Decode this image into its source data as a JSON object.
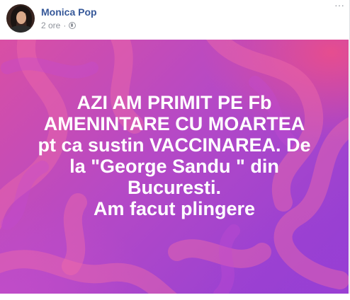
{
  "post": {
    "author_name": "Monica Pop",
    "timestamp": "2 ore",
    "separator": "·",
    "privacy_icon": "globe-icon",
    "more_icon": "ellipsis-icon",
    "more_label": "···",
    "avatar_icon": "profile-photo",
    "text_lines": [
      "AZI AM PRIMIT PE Fb",
      "AMENINTARE CU MOARTEA",
      "pt ca sustin VACCINAREA. De",
      "la \"George Sandu \" din",
      "Bucuresti.",
      "Am facut plingere"
    ],
    "background_colors": [
      "#d94fa4",
      "#b549c6",
      "#8f3ed6"
    ],
    "text_color": "#ffffff",
    "name_color": "#365899",
    "meta_color": "#90949c"
  }
}
